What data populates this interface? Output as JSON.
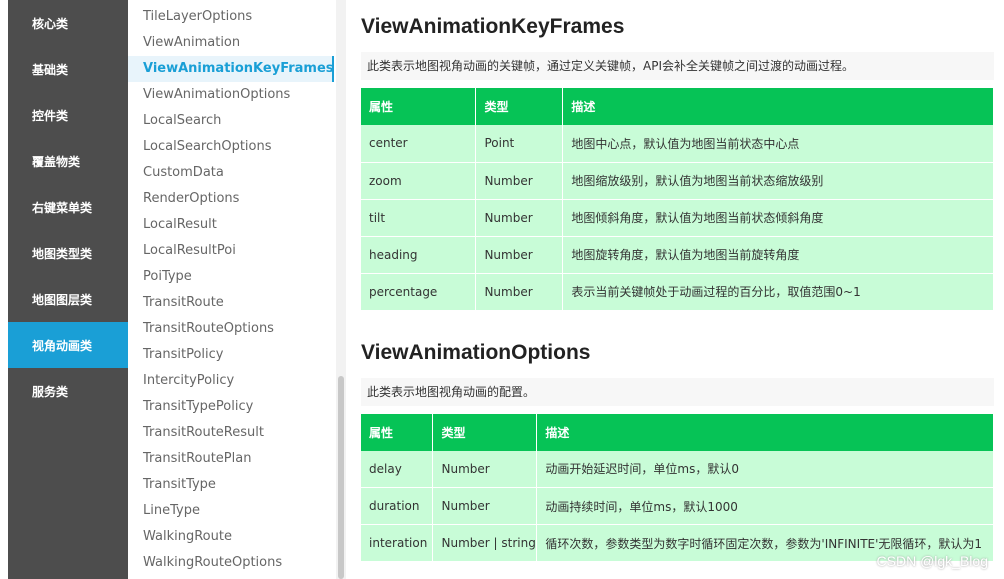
{
  "categories": [
    {
      "label": "核心类",
      "active": false
    },
    {
      "label": "基础类",
      "active": false
    },
    {
      "label": "控件类",
      "active": false
    },
    {
      "label": "覆盖物类",
      "active": false
    },
    {
      "label": "右键菜单类",
      "active": false
    },
    {
      "label": "地图类型类",
      "active": false
    },
    {
      "label": "地图图层类",
      "active": false
    },
    {
      "label": "视角动画类",
      "active": true
    },
    {
      "label": "服务类",
      "active": false
    }
  ],
  "classes": [
    {
      "label": "TileLayerOptions",
      "active": false
    },
    {
      "label": "ViewAnimation",
      "active": false
    },
    {
      "label": "ViewAnimationKeyFrames",
      "active": true
    },
    {
      "label": "ViewAnimationOptions",
      "active": false
    },
    {
      "label": "LocalSearch",
      "active": false
    },
    {
      "label": "LocalSearchOptions",
      "active": false
    },
    {
      "label": "CustomData",
      "active": false
    },
    {
      "label": "RenderOptions",
      "active": false
    },
    {
      "label": "LocalResult",
      "active": false
    },
    {
      "label": "LocalResultPoi",
      "active": false
    },
    {
      "label": "PoiType",
      "active": false
    },
    {
      "label": "TransitRoute",
      "active": false
    },
    {
      "label": "TransitRouteOptions",
      "active": false
    },
    {
      "label": "TransitPolicy",
      "active": false
    },
    {
      "label": "IntercityPolicy",
      "active": false
    },
    {
      "label": "TransitTypePolicy",
      "active": false
    },
    {
      "label": "TransitRouteResult",
      "active": false
    },
    {
      "label": "TransitRoutePlan",
      "active": false
    },
    {
      "label": "TransitType",
      "active": false
    },
    {
      "label": "LineType",
      "active": false
    },
    {
      "label": "WalkingRoute",
      "active": false
    },
    {
      "label": "WalkingRouteOptions",
      "active": false
    }
  ],
  "sections": [
    {
      "title": "ViewAnimationKeyFrames",
      "description": "此类表示地图视角动画的关键帧，通过定义关键帧，API会补全关键帧之间过渡的动画过程。",
      "headers": [
        "属性",
        "类型",
        "描述"
      ],
      "rows": [
        [
          "center",
          "Point",
          "地图中心点，默认值为地图当前状态中心点"
        ],
        [
          "zoom",
          "Number",
          "地图缩放级别，默认值为地图当前状态缩放级别"
        ],
        [
          "tilt",
          "Number",
          "地图倾斜角度，默认值为地图当前状态倾斜角度"
        ],
        [
          "heading",
          "Number",
          "地图旋转角度，默认值为地图当前旋转角度"
        ],
        [
          "percentage",
          "Number",
          "表示当前关键帧处于动画过程的百分比，取值范围0~1"
        ]
      ]
    },
    {
      "title": "ViewAnimationOptions",
      "description": "此类表示地图视角动画的配置。",
      "headers": [
        "属性",
        "类型",
        "描述"
      ],
      "rows": [
        [
          "delay",
          "Number",
          "动画开始延迟时间，单位ms，默认0"
        ],
        [
          "duration",
          "Number",
          "动画持续时间，单位ms，默认1000"
        ],
        [
          "interation",
          "Number | string",
          "循环次数，参数类型为数字时循环固定次数，参数为'INFINITE'无限循环，默认为1"
        ]
      ]
    }
  ],
  "watermark": "CSDN @lgk_Blog",
  "colors": {
    "sidebar": "#4d4d4d",
    "accent": "#1a9fd6",
    "table_header": "#06c356",
    "table_row": "#c8fcd7"
  }
}
